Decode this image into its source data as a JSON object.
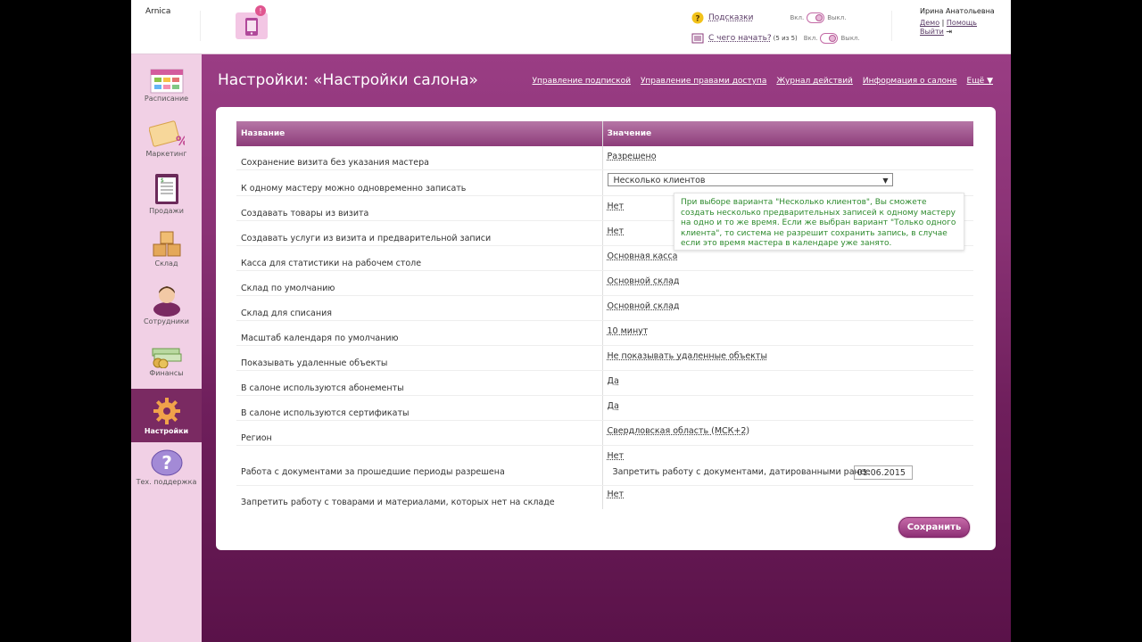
{
  "header": {
    "brand": "Arnica",
    "help_label": "Подсказки",
    "start_label": "С чего начать?",
    "start_count": "(5 из 5)",
    "on_label": "Вкл.",
    "off_label": "Выкл.",
    "user_name": "Ирина Анатольевна",
    "demo_label": "Демо",
    "sep": "|",
    "help_link": "Помощь",
    "logout_label": "Выйти"
  },
  "sidebar": {
    "items": [
      {
        "label": "Расписание",
        "icon": "calendar-icon"
      },
      {
        "label": "Маркетинг",
        "icon": "coupon-icon"
      },
      {
        "label": "Продажи",
        "icon": "receipt-icon"
      },
      {
        "label": "Склад",
        "icon": "boxes-icon"
      },
      {
        "label": "Сотрудники",
        "icon": "person-icon"
      },
      {
        "label": "Финансы",
        "icon": "money-icon"
      },
      {
        "label": "Настройки",
        "icon": "gear-icon"
      },
      {
        "label": "Тех. поддержка",
        "icon": "question-icon"
      }
    ]
  },
  "page": {
    "title": "Настройки: «Настройки салона»",
    "links": [
      "Управление подпиской",
      "Управление правами доступа",
      "Журнал действий",
      "Информация о салоне",
      "Ещё ▼"
    ]
  },
  "table": {
    "col_name": "Название",
    "col_value": "Значение",
    "rows": [
      {
        "name": "Сохранение визита без указания мастера",
        "value": "Разрешено"
      },
      {
        "name": "К одному мастеру можно одновременно записать",
        "value": "Несколько клиентов"
      },
      {
        "name": "Создавать товары из визита",
        "value": "Нет"
      },
      {
        "name": "Создавать услуги из визита и предварительной записи",
        "value": "Нет"
      },
      {
        "name": "Касса для статистики на рабочем столе",
        "value": "Основная касса"
      },
      {
        "name": "Склад по умолчанию",
        "value": "Основной склад"
      },
      {
        "name": "Склад для списания",
        "value": "Основной склад"
      },
      {
        "name": "Масштаб календаря по умолчанию",
        "value": "10 минут"
      },
      {
        "name": "Показывать удаленные объекты",
        "value": "Не показывать удаленные объекты"
      },
      {
        "name": "В салоне используются абонементы",
        "value": "Да"
      },
      {
        "name": "В салоне используются сертификаты",
        "value": "Да"
      },
      {
        "name": "Регион",
        "value": "Свердловская область (МСК+2)"
      },
      {
        "name": "Работа с документами за прошедшие периоды разрешена",
        "value": "Нет",
        "sub_label": "Запретить работу с документами, датированными ранее",
        "sub_date": "01.06.2015"
      },
      {
        "name": "Запретить работу с товарами и материалами, которых нет на складе",
        "value": "Нет"
      }
    ]
  },
  "tooltip": "При выборе варианта \"Несколько клиентов\", Вы сможете создать несколько предварительных записей к одному мастеру на одно и то же время. Если же выбран вариант \"Только одного клиента\", то система не разрешит сохранить запись, в случае если это время мастера в календаре уже занято.",
  "save_label": "Сохранить",
  "colors": {
    "accent": "#8d3c7a",
    "sidebar": "#f1d0e5",
    "tooltip_text": "#2d8a2d"
  }
}
